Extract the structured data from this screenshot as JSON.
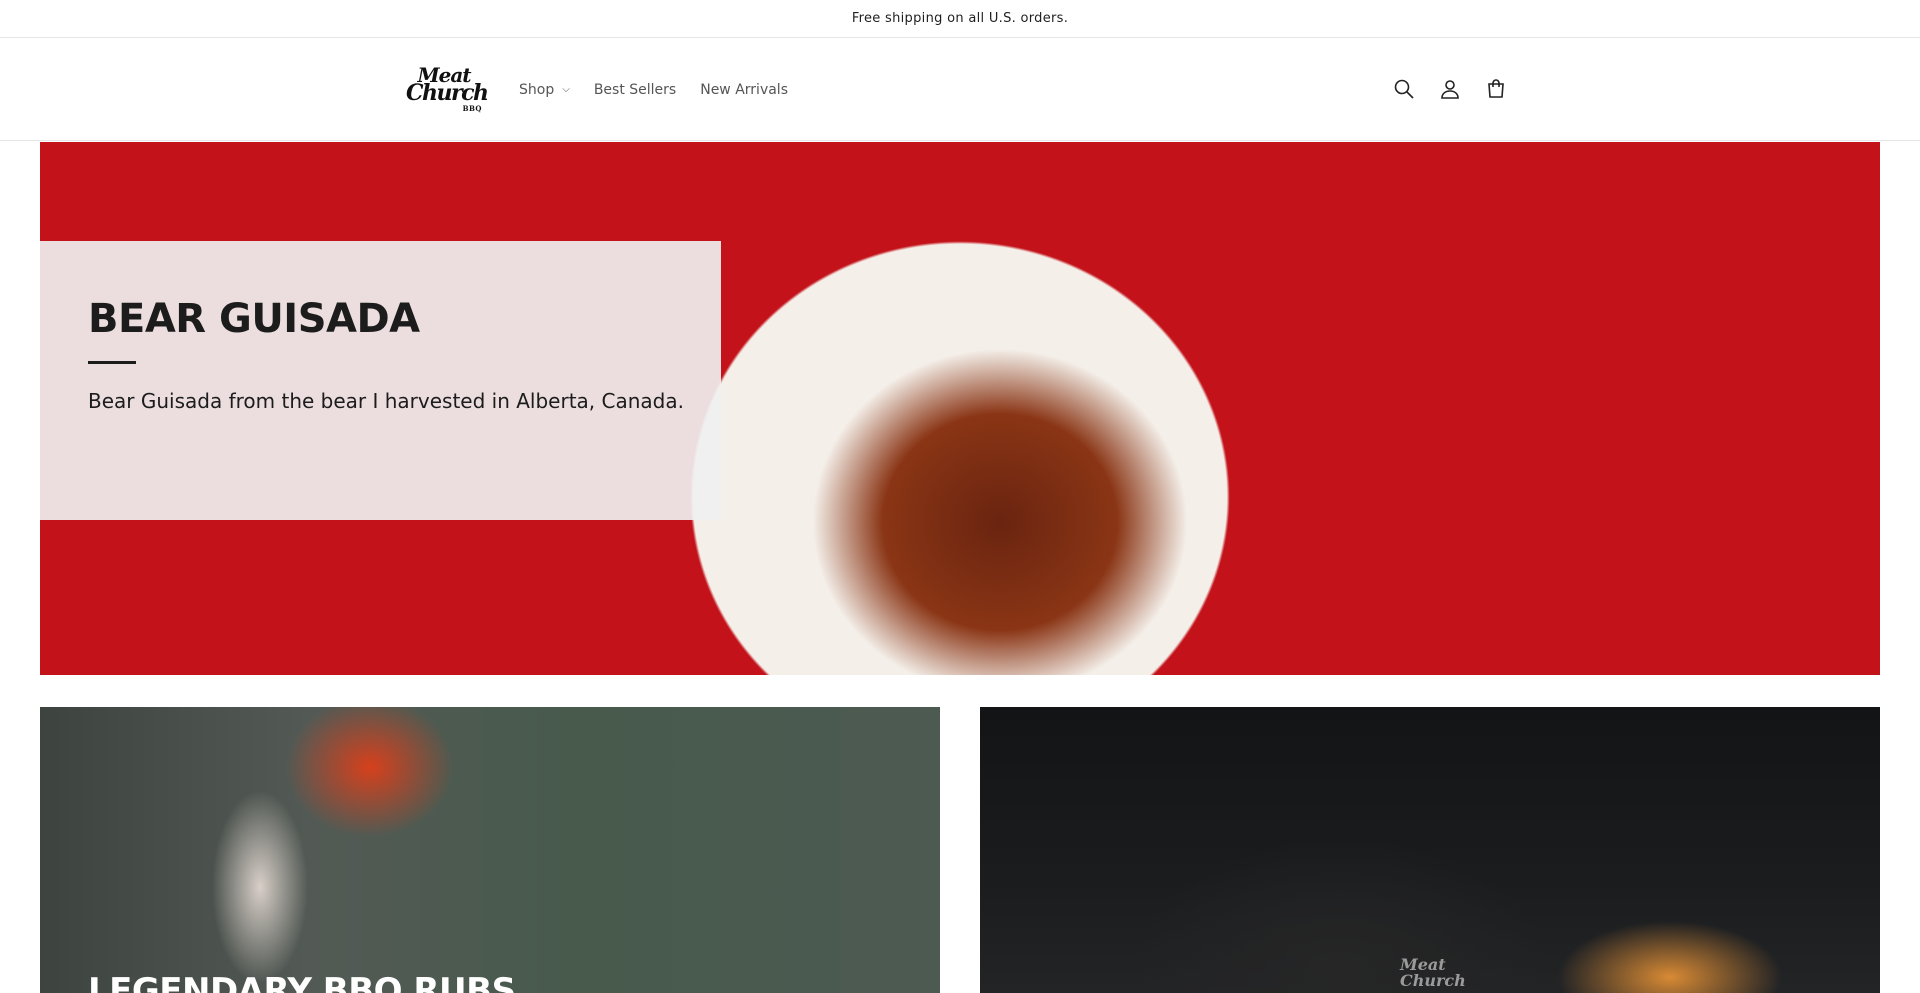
{
  "announcement": {
    "text": "Free shipping on all U.S. orders."
  },
  "header": {
    "logo": {
      "line1": "Meat",
      "line2": "Church",
      "line3": "BBQ"
    },
    "nav": [
      {
        "label": "Shop",
        "has_dropdown": true
      },
      {
        "label": "Best Sellers"
      },
      {
        "label": "New Arrivals"
      }
    ],
    "icons": [
      "search-icon",
      "account-icon",
      "cart-icon"
    ]
  },
  "hero": {
    "title": "BEAR GUISADA",
    "subtitle": "Bear Guisada from the bear I harvested in Alberta, Canada."
  },
  "cards": [
    {
      "title": "LEGENDARY BBQ RUBS"
    },
    {
      "logo_line1": "Meat",
      "logo_line2": "Church"
    }
  ]
}
